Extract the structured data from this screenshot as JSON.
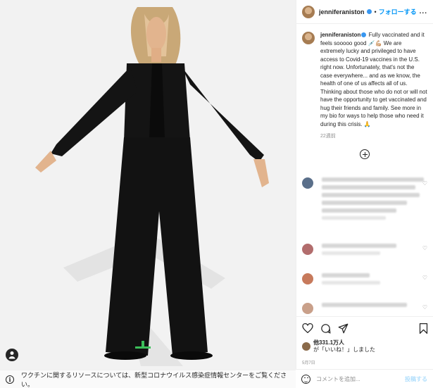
{
  "header": {
    "username": "jenniferaniston",
    "separator": "•",
    "follow_label": "フォローする",
    "more_label": "..."
  },
  "caption": {
    "username": "jenniferaniston",
    "text": " Fully vaccinated and it feels sooooo good 💉💪🏼 We are extremely lucky and privileged to have access to Covid-19 vaccines in the U.S. right now. Unfortunately, that's not the case everywhere... and as we know, the health of one of us affects all of us. Thinking about those who do not or will not have the opportunity to get vaccinated and hug their friends and family. See more in my bio for ways to help those who need it during this crisis. 🙏",
    "time": "22週前"
  },
  "actions": {
    "likes_text": "他331.1万人",
    "likes_text2": "が「いいね！」しました",
    "date": "5月7日"
  },
  "comment_box": {
    "placeholder": "コメントを追加...",
    "post_label": "投稿する"
  },
  "banner": {
    "info_glyph": "i",
    "text": "ワクチンに関するリソースについては、新型コロナウイルス感染症情報センターをご覧ください。"
  },
  "icons": {
    "heart": "heart-icon",
    "comment": "comment-icon",
    "share": "share-icon",
    "save": "bookmark-icon"
  },
  "colors": {
    "accent": "#0095f6",
    "verified": "#3897f0"
  }
}
